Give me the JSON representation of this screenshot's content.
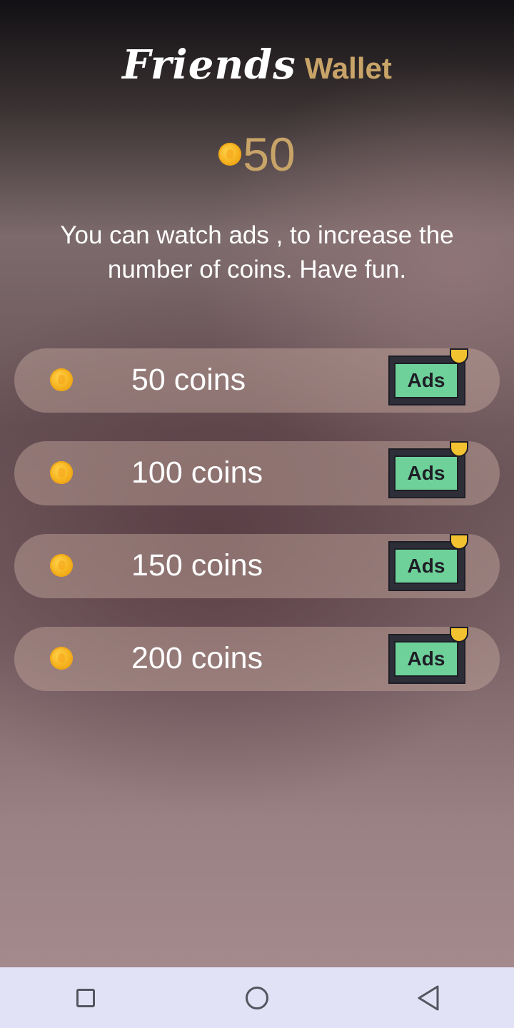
{
  "header": {
    "title_script": "Friends",
    "title_label": "Wallet"
  },
  "balance": {
    "icon": "coin-icon",
    "value": "50"
  },
  "description": "You can watch ads , to increase the number of coins. Have fun.",
  "offers": [
    {
      "label": "50 coins",
      "ad_label": "Ads"
    },
    {
      "label": "100 coins",
      "ad_label": "Ads"
    },
    {
      "label": "150 coins",
      "ad_label": "Ads"
    },
    {
      "label": "200 coins",
      "ad_label": "Ads"
    }
  ],
  "colors": {
    "accent_gold": "#c9a468",
    "coin": "#f5b21e",
    "ads_green": "#6fd19a",
    "navbar_bg": "#e2e2f6"
  },
  "navbar": {
    "icons": [
      "recent-apps-icon",
      "home-icon",
      "back-icon"
    ]
  }
}
